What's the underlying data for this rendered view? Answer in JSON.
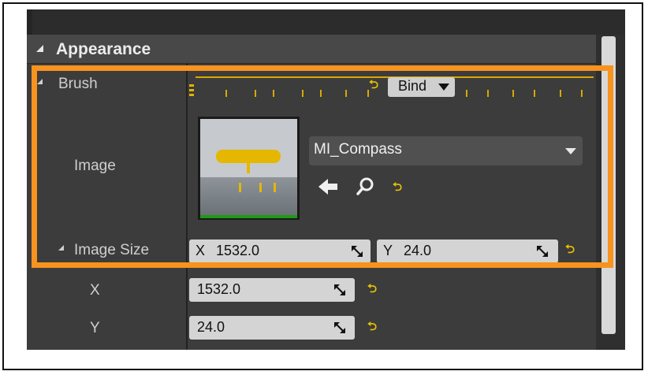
{
  "section": {
    "title": "Appearance"
  },
  "brush": {
    "label": "Brush",
    "bind_label": "Bind",
    "reset_glyph": "⮌"
  },
  "image": {
    "label": "Image",
    "asset": "MI_Compass",
    "icons": [
      "use-selected-arrow-icon",
      "browse-search-icon",
      "reset-to-default-icon"
    ]
  },
  "image_size": {
    "label": "Image Size",
    "x_prefix": "X",
    "x_value": "1532.0",
    "y_prefix": "Y",
    "y_value": "24.0"
  },
  "x_row": {
    "label": "X",
    "value": "1532.0"
  },
  "y_row": {
    "label": "Y",
    "value": "24.0"
  },
  "colors": {
    "panel_bg": "#3c3c3c",
    "accent_yellow": "#e5b700",
    "highlight_orange": "#f7931e"
  }
}
